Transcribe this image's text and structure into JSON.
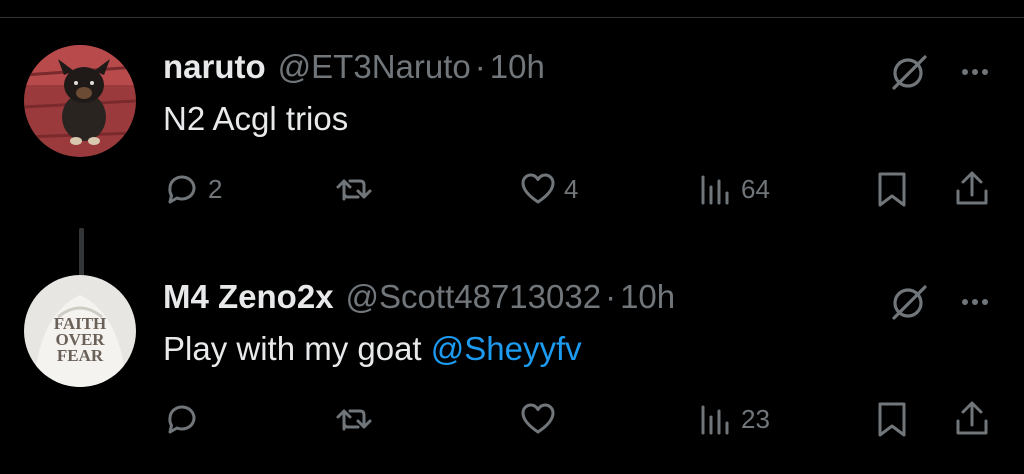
{
  "tweets": [
    {
      "name": "naruto",
      "handle": "@ET3Naruto",
      "separator": "·",
      "time": "10h",
      "text": "N2 Acgl trios",
      "mention": "",
      "reply_count": "2",
      "retweet_count": "",
      "like_count": "4",
      "view_count": "64"
    },
    {
      "name": "M4 Zeno2x",
      "handle": "@Scott48713032",
      "separator": "·",
      "time": "10h",
      "text": "Play with my goat ",
      "mention": "@Sheyyfv",
      "reply_count": "",
      "retweet_count": "",
      "like_count": "",
      "view_count": "23"
    }
  ],
  "avatar_2_text": [
    "FAITH",
    "OVER",
    "FEAR"
  ],
  "colors": {
    "background": "#000000",
    "text_primary": "#e7e9ea",
    "text_secondary": "#71767b",
    "accent": "#1d9bf0",
    "divider": "#2f3336"
  },
  "icons": [
    "reply-icon",
    "retweet-icon",
    "like-icon",
    "views-icon",
    "bookmark-icon",
    "share-icon",
    "grok-icon",
    "more-icon"
  ]
}
